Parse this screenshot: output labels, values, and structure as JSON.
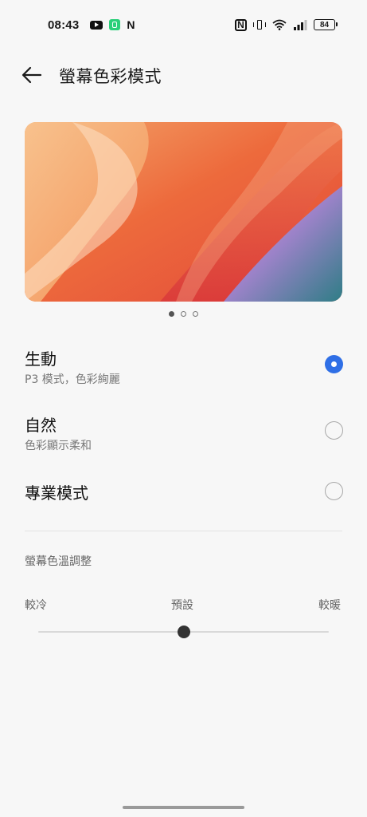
{
  "status_bar": {
    "time": "08:43",
    "app_icons": [
      "youtube-icon",
      "green-app-icon",
      "netflix-icon"
    ],
    "netflix_glyph": "N",
    "nfc_glyph": "N",
    "battery_level": "84"
  },
  "header": {
    "title": "螢幕色彩模式",
    "back_icon": "arrow-left-icon"
  },
  "preview": {
    "page_count": 3,
    "active_page": 1,
    "colors": [
      "#f08a4b",
      "#e95a3a",
      "#f4b27a",
      "#9b7fc7",
      "#2f7d86"
    ]
  },
  "options": [
    {
      "label": "生動",
      "sub": "P3 模式，色彩絢麗",
      "selected": true
    },
    {
      "label": "自然",
      "sub": "色彩顯示柔和",
      "selected": false
    },
    {
      "label": "專業模式",
      "sub": "",
      "selected": false
    }
  ],
  "temperature": {
    "title": "螢幕色溫調整",
    "left_label": "較冷",
    "center_label": "預設",
    "right_label": "較暖",
    "value": 0.5
  },
  "colors": {
    "accent": "#2f6fe6",
    "background": "#f7f7f7"
  }
}
